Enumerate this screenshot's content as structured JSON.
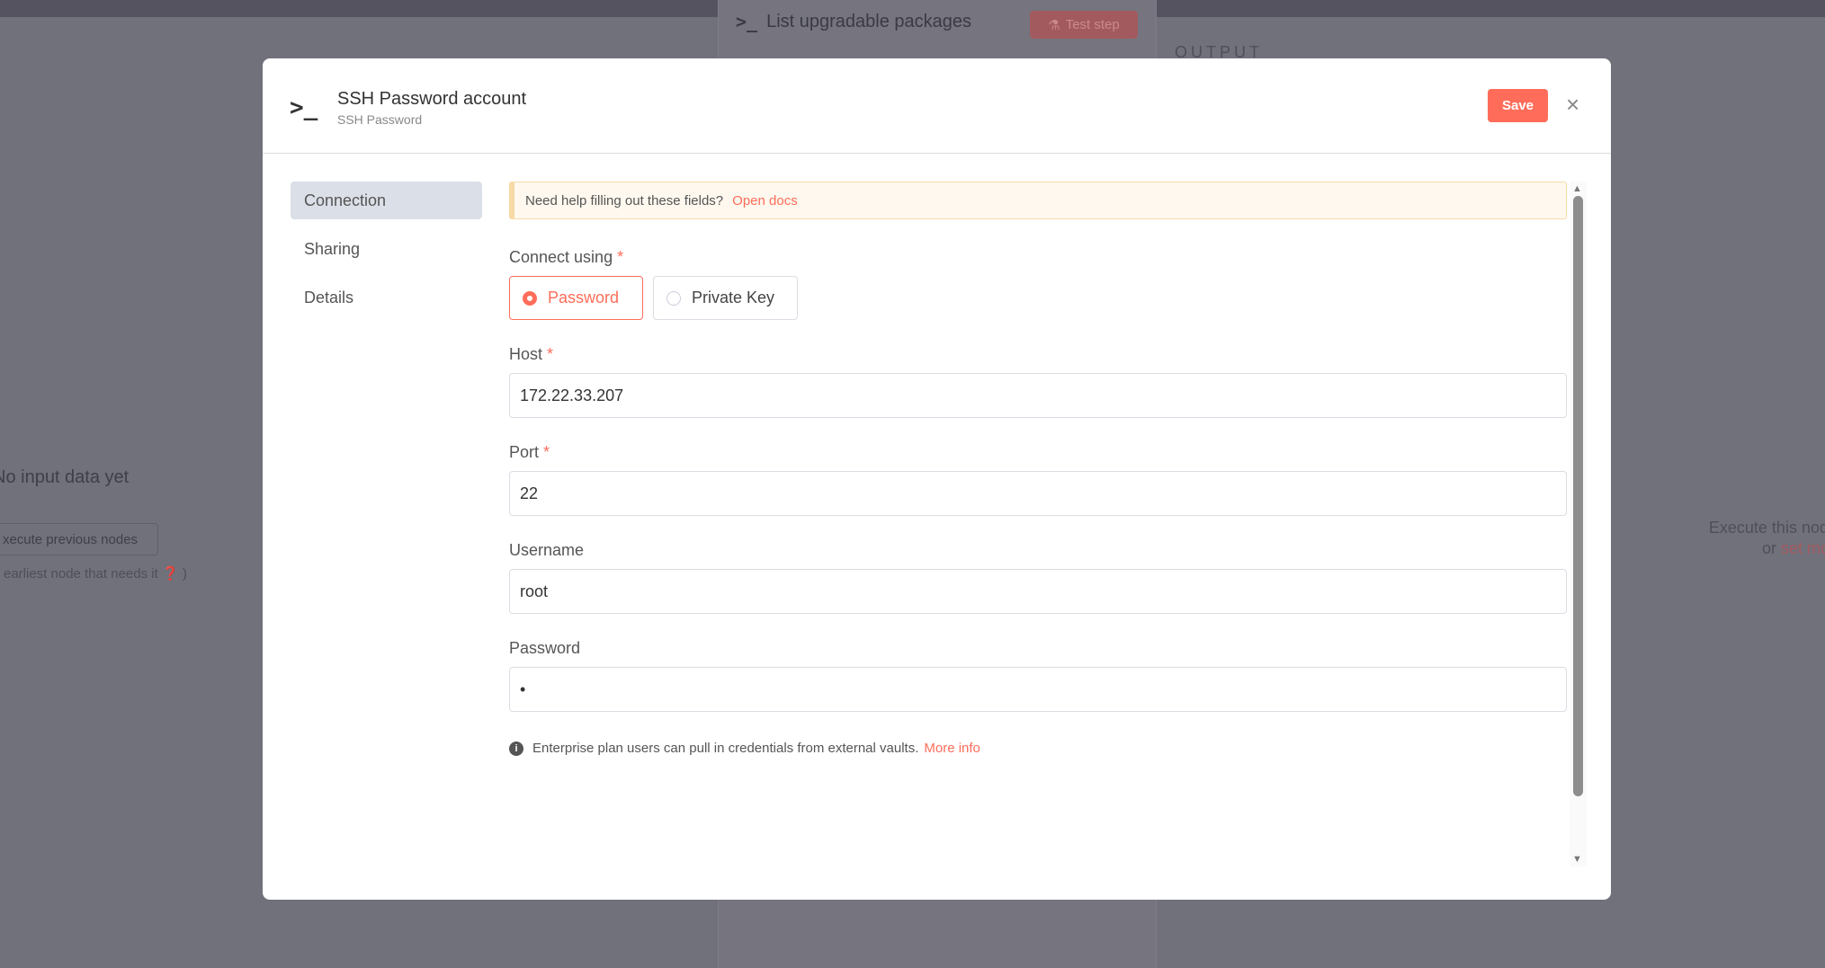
{
  "background": {
    "panel_title": "List upgradable packages",
    "test_step": "Test step",
    "output_label": "OUTPUT",
    "no_input": "No input data yet",
    "execute_previous": "xecute previous nodes",
    "hint": "earliest node that needs it",
    "hint_close": ")",
    "execute_this": "Execute this node",
    "or": "or",
    "set_mock": "set moc"
  },
  "modal": {
    "icon": "terminal-icon",
    "title": "SSH Password account",
    "subtitle": "SSH Password",
    "save_label": "Save",
    "close_icon": "×",
    "sidebar": [
      {
        "label": "Connection",
        "active": true
      },
      {
        "label": "Sharing"
      },
      {
        "label": "Details"
      }
    ],
    "notice": {
      "text": "Need help filling out these fields?",
      "link": "Open docs"
    },
    "connect_using": {
      "label": "Connect using",
      "required": "*",
      "options": [
        "Password",
        "Private Key"
      ],
      "selected": "Password"
    },
    "fields": [
      {
        "label": "Host",
        "required": "*",
        "value": "172.22.33.207"
      },
      {
        "label": "Port",
        "required": "*",
        "value": "22"
      },
      {
        "label": "Username",
        "required": "",
        "value": "root"
      },
      {
        "label": "Password",
        "required": "",
        "value": "•"
      }
    ],
    "info": {
      "text": "Enterprise plan users can pull in credentials from external vaults.",
      "link": "More info"
    }
  },
  "colors": {
    "accent": "#ff6d5a",
    "overlay": "#71717c",
    "notice_bg": "#fef8ee"
  }
}
